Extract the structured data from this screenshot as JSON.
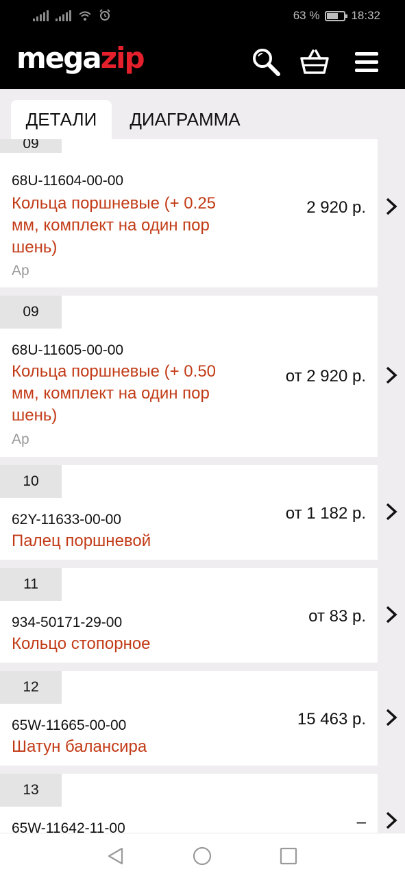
{
  "status_bar": {
    "battery_percent": "63 %",
    "battery_level": 0.63,
    "time": "18:32",
    "icons": [
      "signal-icon",
      "signal-icon",
      "wifi-icon",
      "alarm-icon",
      "battery-icon"
    ]
  },
  "header": {
    "logo_part1": "mega",
    "logo_part2": "zip",
    "brand_color": "#e3202b",
    "icons": [
      "search-icon",
      "cart-icon",
      "menu-icon"
    ]
  },
  "tabs": [
    {
      "label": "ДЕТАЛИ",
      "active": true
    },
    {
      "label": "ДИАГРАММА",
      "active": false
    }
  ],
  "items": [
    {
      "position": "09",
      "code": "68U-11604-00-00",
      "name_lines": [
        "Кольца поршневые (+ 0.25",
        "мм, комплект на один пор",
        "шень)"
      ],
      "brand": "Ap",
      "price": "2 920 р."
    },
    {
      "position": "09",
      "code": "68U-11605-00-00",
      "name_lines": [
        "Кольца поршневые (+ 0.50",
        "мм, комплект на один пор",
        "шень)"
      ],
      "brand": "Ap",
      "price": "от 2 920 р."
    },
    {
      "position": "10",
      "code": "62Y-11633-00-00",
      "name_lines": [
        "Палец поршневой"
      ],
      "brand": "",
      "price": "от 1 182 р."
    },
    {
      "position": "11",
      "code": "934-50171-29-00",
      "name_lines": [
        "Кольцо стопорное"
      ],
      "brand": "",
      "price": "от 83 р."
    },
    {
      "position": "12",
      "code": "65W-11665-00-00",
      "name_lines": [
        "Шатун балансира"
      ],
      "brand": "",
      "price": "15 463 р."
    },
    {
      "position": "13",
      "code": "65W-11642-11-00",
      "name_lines": [],
      "brand": "",
      "price": "–"
    }
  ],
  "colors": {
    "name": "#c23b17",
    "price": "#111111"
  },
  "navbar": {
    "icons": [
      "back-icon",
      "home-icon",
      "recents-icon"
    ]
  }
}
